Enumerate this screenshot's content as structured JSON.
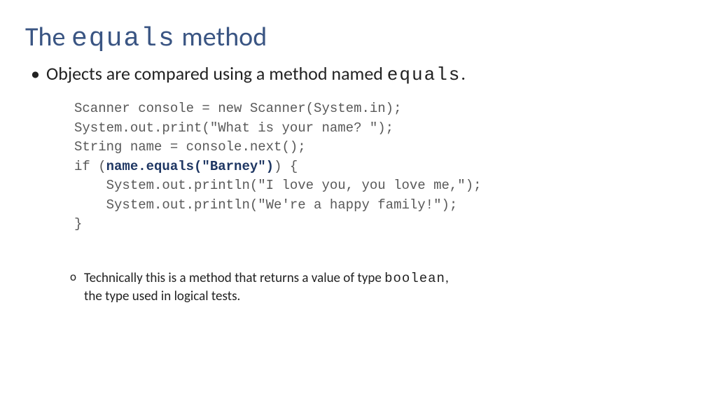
{
  "title": {
    "pre": "The ",
    "code": "equals",
    "post": " method"
  },
  "bullet": {
    "pre": "Objects are compared using a method named ",
    "code": "equals",
    "post": "."
  },
  "code": {
    "l1": "Scanner console = new Scanner(System.in);",
    "l2": "System.out.print(\"What is your name? \");",
    "l3": "String name = console.next();",
    "l4a": "if (",
    "l4b": "name.equals(\"Barney\")",
    "l4c": ") {",
    "l5": "    System.out.println(\"I love you, you love me,\");",
    "l6": "    System.out.println(\"We're a happy family!\");",
    "l7": "}"
  },
  "sub": {
    "pre": "Technically this is a method that returns a value of type ",
    "code": "boolean",
    "post": ",",
    "line2": "the type used in logical tests."
  }
}
